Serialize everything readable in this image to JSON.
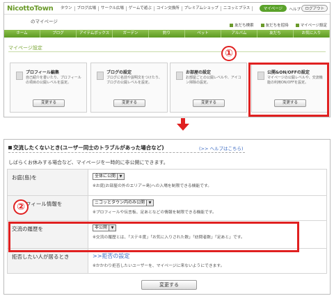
{
  "header": {
    "logo": "NicottoTown",
    "nav_links": [
      "タウン",
      "ブログ広場",
      "サークル広場",
      "ゲームで遊ぶ",
      "コイン交換所",
      "プレミアムショップ",
      "ニコッとプラス"
    ],
    "mypage_label": "マイページ",
    "help_label": "ヘルプ",
    "logout_label": "ログアウト"
  },
  "subheader": {
    "title": "のマイページ",
    "links": [
      "友だち検索",
      "友だちを招待",
      "マイページ設定"
    ]
  },
  "green_nav": {
    "items": [
      "ホーム",
      "ブログ",
      "アイテムボックス",
      "ガーデン",
      "釣り",
      "ペット",
      "アルバム",
      "友だち",
      "お気に入り"
    ]
  },
  "mypage_settings": {
    "title": "マイページ設定",
    "badge": "①",
    "cards": [
      {
        "title": "プロフィール編集",
        "desc": "自己紹介を書いたり、プロフィールの項目の公開レベルを設定。",
        "button": "変更する"
      },
      {
        "title": "ブログの設定",
        "desc": "ブログに名前や説明文をつけたり、ブログの公開レベルを設定。",
        "button": "変更する"
      },
      {
        "title": "お部屋の設定",
        "desc": "お部屋ごとの公開レベルや、アイコン掃除の設定。",
        "button": "変更する"
      },
      {
        "title": "公開&ON/OFFの設定",
        "desc": "マイページの公開レベルや、交流機能の利用ON/OFFを設定。",
        "button": "変更する"
      }
    ]
  },
  "exchange_section": {
    "title": "交流したくないとき(ユーザー同士のトラブルがあった場合など)",
    "help_link": "(>> ヘルプはこちら)",
    "intro": "しばらくお休みする場合など、マイページを一時的に非公開にできます。",
    "badge": "②",
    "rows": [
      {
        "label": "お庭(島)を",
        "select": "全体に公開",
        "note": "※お庭(お部屋の外のエリア＝島)への入場を制限できる機能です。"
      },
      {
        "label": "フィール情報を",
        "select": "ニコッとタウン内のみ公開",
        "note": "※プロフィールや伝言板、足あとなどの情報を制限できる機能です。"
      },
      {
        "label": "交流の履歴を",
        "select": "非公開",
        "note": "※交流の履歴とは、「ステキ度」「お気に入りされた数」「訪問者数」「足あと」です。"
      },
      {
        "label": "拒否したい人が居るとき",
        "link": ">>拒否の設定",
        "note": "※かかわり拒否したいユーザーを、マイページに来ないようにできます。"
      }
    ],
    "submit": "変更する"
  },
  "colors": {
    "accent": "#6a9a2a",
    "highlight": "#e02020",
    "link": "#3b6ac2"
  }
}
